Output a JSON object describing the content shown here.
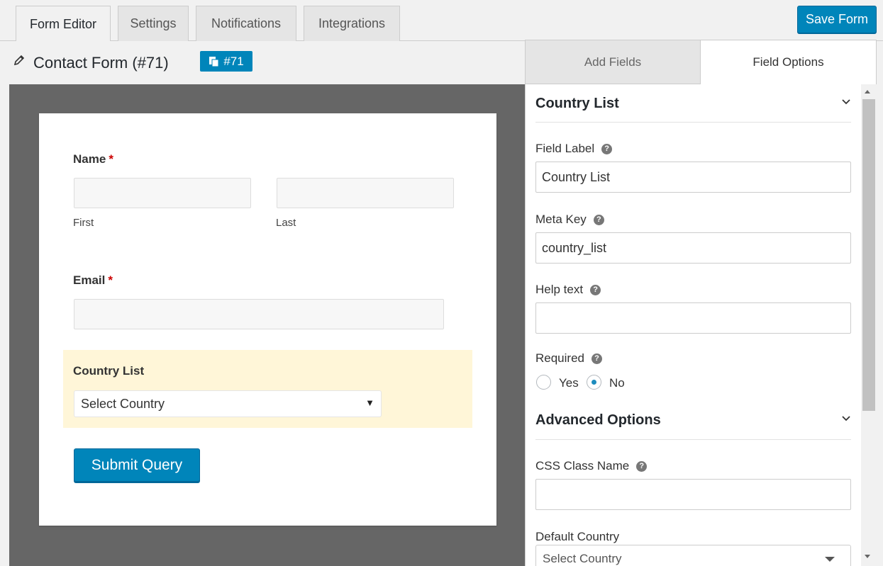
{
  "tabs": [
    {
      "label": "Form Editor",
      "active": true
    },
    {
      "label": "Settings",
      "active": false
    },
    {
      "label": "Notifications",
      "active": false
    },
    {
      "label": "Integrations",
      "active": false
    }
  ],
  "save_button": "Save Form",
  "form": {
    "title": "Contact Form (#71)",
    "id_badge": "#71"
  },
  "preview": {
    "name_label": "Name",
    "required_mark": "*",
    "first_sublabel": "First",
    "last_sublabel": "Last",
    "email_label": "Email",
    "country_label": "Country List",
    "country_select": "Select Country",
    "submit_button": "Submit Query"
  },
  "panel": {
    "tab_add": "Add Fields",
    "tab_options": "Field Options",
    "section_title": "Country List",
    "field_label_label": "Field Label",
    "field_label_value": "Country List",
    "meta_key_label": "Meta Key",
    "meta_key_value": "country_list",
    "help_text_label": "Help text",
    "help_text_value": "",
    "required_label": "Required",
    "required_yes": "Yes",
    "required_no": "No",
    "required_selected": "No",
    "advanced_title": "Advanced Options",
    "css_class_label": "CSS Class Name",
    "css_class_value": "",
    "default_country_label": "Default Country",
    "default_country_value": "Select Country"
  },
  "colors": {
    "primary": "#0085ba",
    "highlight": "#fff6d8",
    "required": "#cc0000",
    "canvas": "#666666"
  }
}
